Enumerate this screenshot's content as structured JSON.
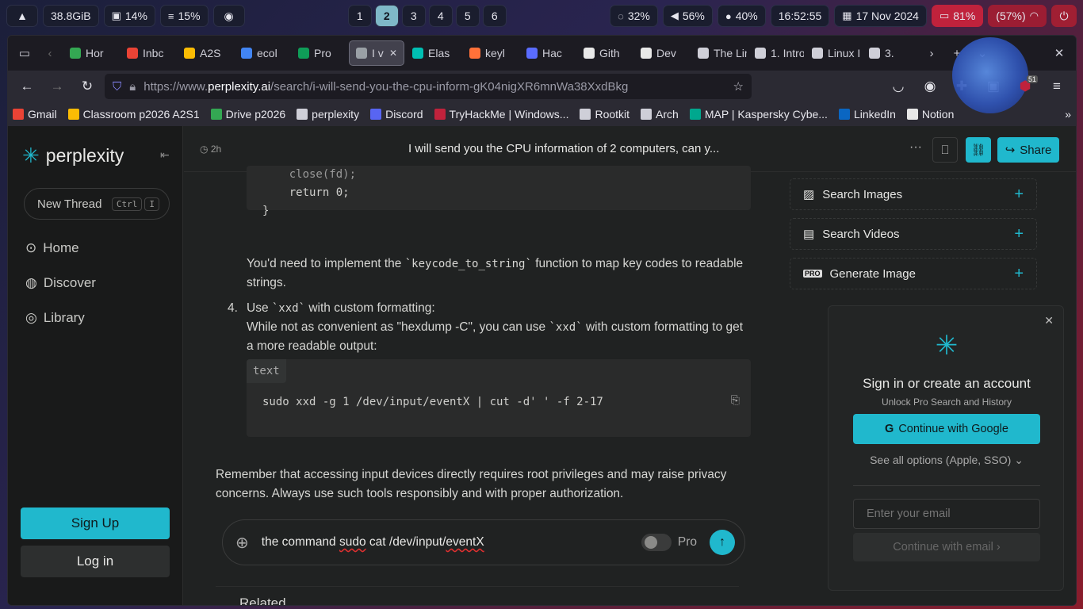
{
  "sysbar": {
    "memory": "38.8GiB",
    "cpu": "14%",
    "load": "15%",
    "workspaces": [
      "1",
      "2",
      "3",
      "4",
      "5",
      "6"
    ],
    "active_workspace": "2",
    "brightness": "32%",
    "volume": "56%",
    "mic": "40%",
    "time": "16:52:55",
    "date": "17 Nov 2024",
    "battery": "81%",
    "vpn": "(57%)"
  },
  "tabs": [
    {
      "label": "Hor",
      "color": "#34a853"
    },
    {
      "label": "Inbc",
      "color": "#ea4335"
    },
    {
      "label": "A2S",
      "color": "#fbbc04"
    },
    {
      "label": "ecol",
      "color": "#4285f4"
    },
    {
      "label": "Pro",
      "color": "#0f9d58"
    },
    {
      "label": "I v",
      "color": "#9aa0a6"
    },
    {
      "label": "Elas",
      "color": "#00bfb3"
    },
    {
      "label": "keyl",
      "color": "#ff7139"
    },
    {
      "label": "Hac",
      "color": "#5a6cff"
    },
    {
      "label": "Gith",
      "color": "#e8e8e8"
    },
    {
      "label": "Dev",
      "color": "#e8e8e8"
    },
    {
      "label": "The Lin",
      "color": "#cfcfd8"
    },
    {
      "label": "1. Intro",
      "color": "#cfcfd8"
    },
    {
      "label": "Linux Ir",
      "color": "#cfcfd8"
    },
    {
      "label": "3.",
      "color": "#cfcfd8"
    }
  ],
  "url": {
    "prefix": "https://www.",
    "domain": "perplexity.ai",
    "path": "/search/i-will-send-you-the-cpu-inform-gK04nigXR6mnWa38XxdBkg"
  },
  "notifications_badge": "51",
  "bookmarks": [
    {
      "label": "Gmail",
      "color": "#ea4335"
    },
    {
      "label": "Classroom p2026 A2S1",
      "color": "#fbbc04"
    },
    {
      "label": "Drive p2026",
      "color": "#34a853"
    },
    {
      "label": "perplexity",
      "color": "#cfcfd8"
    },
    {
      "label": "Discord",
      "color": "#5865f2"
    },
    {
      "label": "TryHackMe | Windows...",
      "color": "#c0223c"
    },
    {
      "label": "Rootkit",
      "color": "#cfcfd8"
    },
    {
      "label": "Arch",
      "color": "#cfcfd8"
    },
    {
      "label": "MAP | Kaspersky Cybe...",
      "color": "#00a88e"
    },
    {
      "label": "LinkedIn",
      "color": "#0a66c2"
    },
    {
      "label": "Notion",
      "color": "#e8e8e8"
    }
  ],
  "sidebar": {
    "brand": "perplexity",
    "new_thread": "New Thread",
    "kbd": [
      "Ctrl",
      "I"
    ],
    "nav": [
      "Home",
      "Discover",
      "Library"
    ],
    "signup": "Sign Up",
    "login": "Log in"
  },
  "thread": {
    "age": "2h",
    "title": "I will send you the CPU information of 2 computers, can y...",
    "share": "Share"
  },
  "content": {
    "code1": [
      "    close(fd);",
      "    return 0;",
      "}"
    ],
    "p1_a": "You'd need to implement the ",
    "p1_code": "`keycode_to_string`",
    "p1_b": " function to map key codes to readable strings.",
    "item_num": "4.",
    "item_title_a": "Use ",
    "item_title_code": "`xxd`",
    "item_title_b": " with custom formatting:",
    "item_body_a": "While not as convenient as \"hexdump -C\", you can use ",
    "item_body_code": "`xxd`",
    "item_body_b": " with custom formatting to get a more readable output:",
    "code2_lang": "text",
    "code2": "sudo xxd -g 1 /dev/input/eventX | cut -d' ' -f 2-17",
    "closing": "Remember that accessing input devices directly requires root privileges and may raise privacy concerns. Always use such tools responsibly and with proper authorization.",
    "related": "Related"
  },
  "composer": {
    "text_a": "the command ",
    "text_sudo": "sudo",
    "text_b": " cat /dev/input/",
    "text_event": "eventX",
    "pro": "Pro"
  },
  "right": {
    "cards": [
      "Search Images",
      "Search Videos",
      "Generate Image"
    ]
  },
  "modal": {
    "title": "Sign in or create an account",
    "subtitle": "Unlock Pro Search and History",
    "google": "Continue with Google",
    "options": "See all options (Apple, SSO)",
    "email_placeholder": "Enter your email",
    "email_btn": "Continue with email"
  }
}
